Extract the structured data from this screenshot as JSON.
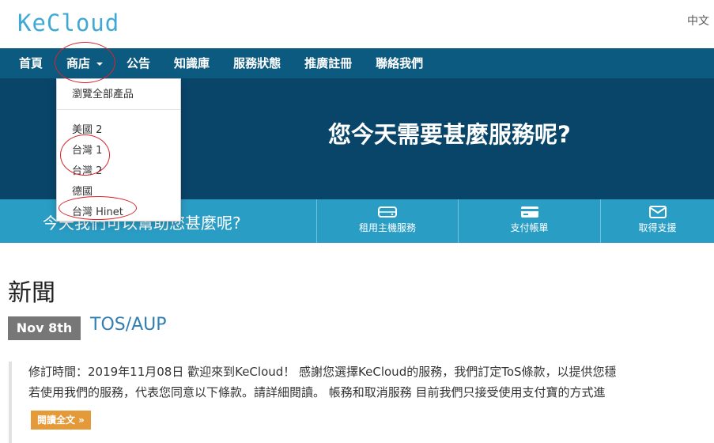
{
  "header": {
    "logo": "KeCloud",
    "language": "中文"
  },
  "nav": {
    "items": [
      {
        "label": "首頁"
      },
      {
        "label": "商店"
      },
      {
        "label": "公告"
      },
      {
        "label": "知識庫"
      },
      {
        "label": "服務狀態"
      },
      {
        "label": "推廣註冊"
      },
      {
        "label": "聯絡我們"
      }
    ]
  },
  "dropdown": {
    "items": [
      {
        "label": "瀏覽全部產品"
      },
      {
        "label": "美國 2"
      },
      {
        "label": "台灣 1"
      },
      {
        "label": "台灣 2"
      },
      {
        "label": "德國"
      },
      {
        "label": "台灣 Hinet"
      }
    ]
  },
  "hero": {
    "title": "您今天需要甚麼服務呢?"
  },
  "strip": {
    "text": "今天我們可以幫助您甚麼呢?",
    "buttons": [
      {
        "label": "租用主機服務",
        "icon": "server-icon"
      },
      {
        "label": "支付帳單",
        "icon": "credit-card-icon"
      },
      {
        "label": "取得支援",
        "icon": "envelope-icon"
      }
    ]
  },
  "news": {
    "heading": "新聞",
    "post": {
      "date": "Nov 8th",
      "title": "TOS/AUP",
      "line1": "修訂時間：2019年11月08日 歡迎來到KeCloud！ 感謝您選擇KeCloud的服務，我們訂定ToS條款，以提供您穩",
      "line2": "若使用我們的服務，代表您同意以下條款。請詳細閱讀。 帳務和取消服務 目前我們只接受使用支付寶的方式進",
      "readmore": "閱讀全文 »"
    }
  },
  "colors": {
    "nav": "#0d5a80",
    "hero": "#084569",
    "strip": "#2a9dc5",
    "accent": "#e59a3a",
    "annotation": "#d9242b"
  }
}
